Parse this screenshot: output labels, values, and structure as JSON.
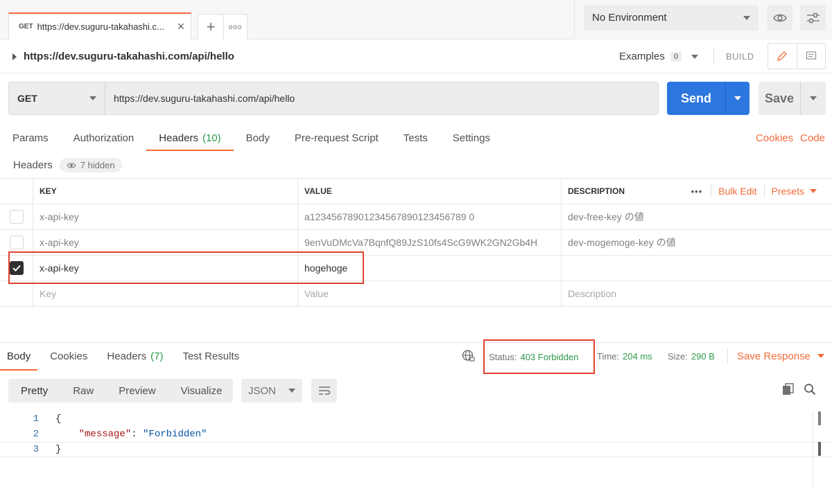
{
  "tab": {
    "method": "GET",
    "title": "https://dev.suguru-takahashi.c..."
  },
  "environment": {
    "selected": "No Environment"
  },
  "request_title": {
    "url": "https://dev.suguru-takahashi.com/api/hello",
    "examples_label": "Examples",
    "examples_count": "0",
    "build_label": "BUILD"
  },
  "request": {
    "method": "GET",
    "url": "https://dev.suguru-takahashi.com/api/hello",
    "send_label": "Send",
    "save_label": "Save"
  },
  "request_tabs": {
    "params": "Params",
    "authorization": "Authorization",
    "headers": "Headers",
    "headers_count": "(10)",
    "body": "Body",
    "prerequest": "Pre-request Script",
    "tests": "Tests",
    "settings": "Settings",
    "cookies": "Cookies",
    "code": "Code"
  },
  "headers_section": {
    "title": "Headers",
    "hidden": "7 hidden"
  },
  "headers_table": {
    "columns": {
      "key": "KEY",
      "value": "VALUE",
      "description": "DESCRIPTION"
    },
    "bulk_edit": "Bulk Edit",
    "presets": "Presets",
    "more": "•••",
    "rows": [
      {
        "key": "x-api-key",
        "value": "a1234567890123456789012345678 90",
        "description": "dev-free-key の値",
        "checked": false
      },
      {
        "key": "x-api-key",
        "value": "9enVuDMcVa7BqnfQ89JzS10fs4ScG9WK2GN2Gb4H",
        "description": "dev-mogemoge-key の値",
        "checked": true
      },
      {
        "key": "x-api-key",
        "value": "hogehoge",
        "description": "",
        "checked": true
      }
    ],
    "placeholders": {
      "key": "Key",
      "value": "Value",
      "description": "Description"
    }
  },
  "response": {
    "tabs": {
      "body": "Body",
      "cookies": "Cookies",
      "headers": "Headers",
      "headers_count": "(7)",
      "test_results": "Test Results"
    },
    "status_label": "Status:",
    "status_value": "403 Forbidden",
    "time_label": "Time:",
    "time_value": "204 ms",
    "size_label": "Size:",
    "size_value": "290 B",
    "save_response": "Save Response",
    "views": {
      "pretty": "Pretty",
      "raw": "Raw",
      "preview": "Preview",
      "visualize": "Visualize"
    },
    "format": "JSON",
    "code_lines": {
      "l1": "{",
      "l2_key": "\"message\"",
      "l2_colon": ": ",
      "l2_val": "\"Forbidden\"",
      "l3": "}"
    },
    "line_numbers": [
      "1",
      "2",
      "3"
    ]
  },
  "colors": {
    "accent": "#f26b3a",
    "send": "#2b76df",
    "success_text": "#2e9a4a",
    "highlight_box": "#e0412e"
  }
}
